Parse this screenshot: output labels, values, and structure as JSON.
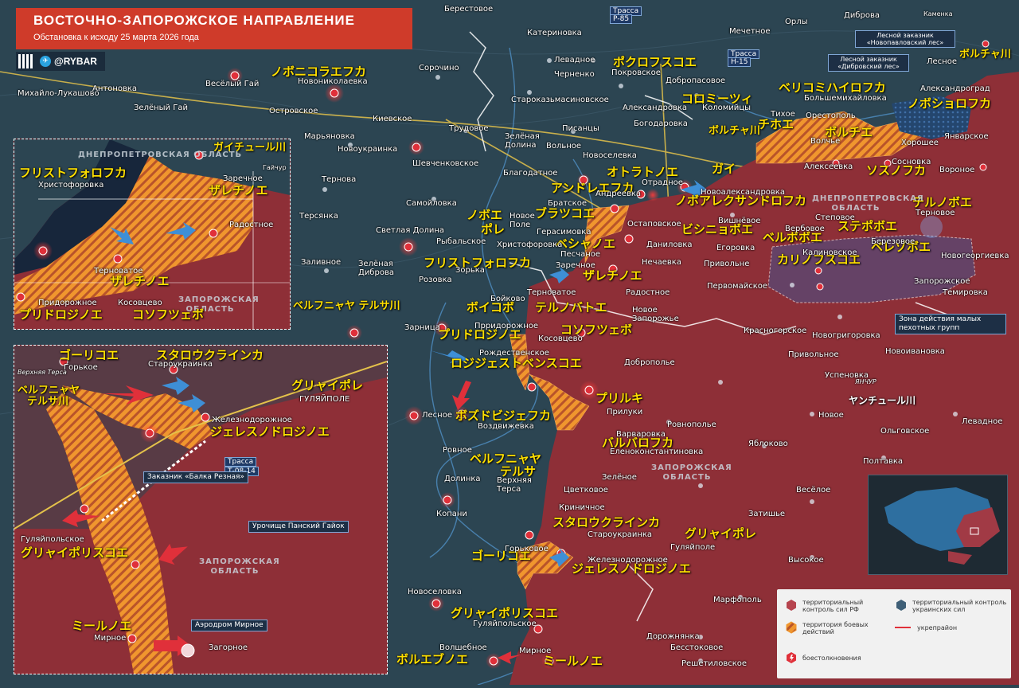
{
  "header": {
    "title": "ВОСТОЧНО-ЗАПОРОЖСКОЕ НАПРАВЛЕНИЕ",
    "subtitle": "Обстановка к исходу 25 марта 2026 года",
    "brand": "@RYBAR"
  },
  "colors": {
    "ru_control": "#8e2f37",
    "ua_control": "#2c4552",
    "contested": "#f0962e",
    "clash": "#e0303a",
    "jp_label": "#ffe000",
    "header_red": "#cf3b2a"
  },
  "jp_labels": [
    "ノボニコラエフカ",
    "ポクロフスコエ",
    "ボルチャ川",
    "ベリコミハイロフカ",
    "ノボショロフカ",
    "コロミーツィ",
    "ボルチャ川",
    "チホエ",
    "ボルチエ",
    "ソスノフカ",
    "オトラトノエ",
    "ガイ",
    "アンドレエフカ",
    "ノボアレクサンドロフカ",
    "テルノボエ",
    "ノボエ",
    "ブラツコエ",
    "ポレ",
    "ベシャノエ",
    "ビシニョボエ",
    "ステポボエ",
    "ベルボボエ",
    "ベレゾボエ",
    "カリノフスコエ",
    "フリストフォロフカ",
    "ザレチノエ",
    "ボイコボ",
    "テルノバトエ",
    "コソフツェボ",
    "プリドロジノエ",
    "ロジジェストベンスコエ",
    "プリルキ",
    "ボズドビジェフカ",
    "バルバロフカ",
    "ベルフニャヤ",
    "テルサ",
    "スタロウクラインカ",
    "グリャイポレ",
    "ゴーリコエ",
    "ジェレスノドロジノエ",
    "グリャイポリスコエ",
    "ボルエブノエ",
    "ミールノエ",
    "ベルフニャヤ テルサ川"
  ],
  "places": [
    "Берестовое",
    "Трасса",
    "Р-85",
    "Каменка",
    "Дибровa",
    "Орлы",
    "Мечетное",
    "Дибровa",
    "Катериновка",
    "Весёлый Гай",
    "Михайло-Лукашово",
    "Антоновка",
    "Зелёный Гай",
    "Новониколаевка",
    "Островское",
    "Сорочино",
    "Левадное",
    "Черненко",
    "Покровское",
    "Добропасовое",
    "Трасса",
    "Н-15",
    "Лесной заказник «Новопавловский лес»",
    "Лесной заказник «Дибровский лес»",
    "Лесное",
    "Александроград",
    "Большемихайловка",
    "Коломийцы",
    "Киевское",
    "Трудовое",
    "Писанцы",
    "Богодаровка",
    "Александровка",
    "Староказьмасиновское",
    "Вольное",
    "Новоселевка",
    "Зелёная Долина",
    "Благодатное",
    "Марьяновка",
    "Новоукраинка",
    "Шевченковское",
    "Тернова",
    "Самойловка",
    "Терсянка",
    "Светлая Долина",
    "Зелёная Диброва",
    "Заливное",
    "Розовка",
    "Рыбальское",
    "Зорька",
    "Андреевка",
    "Братское",
    "Отрадное",
    "Новоалександровка",
    "Хорошее",
    "Сосновка",
    "Вороное",
    "Алексеевка",
    "Тихое",
    "Орестополь",
    "Волчье",
    "Январское",
    "Терновое",
    "Новогеоргиевка",
    "Запорожское",
    "Темировка",
    "Степовое",
    "Березовое",
    "Вербовое",
    "Калиновское",
    "Егоровка",
    "Вишнёвое",
    "Привольне",
    "Первомайское",
    "Нечаевка",
    "Даниловка",
    "Остаповское",
    "Герасимовка",
    "Новое Поле",
    "Христофоровка",
    "Песчаное",
    "Заречное",
    "Терноватое",
    "Бойково",
    "Радостное",
    "Новое Запорожье",
    "Красногорское",
    "Новогригоровка",
    "Новоивановка",
    "Прридорожное",
    "Косовцево",
    "Зарница",
    "Рождественское",
    "Добропольe",
    "Привольное",
    "Успеновка",
    "Лесное",
    "Прилуки",
    "Воздвижевка",
    "Ровнополье",
    "Варваровка",
    "Еленоконстантиновка",
    "Яблоково",
    "Новое",
    "Ольговское",
    "Левадное",
    "Полтавка",
    "Ровное",
    "Долинка",
    "Верхняя Терса",
    "Цветковое",
    "Зелёное",
    "Копани",
    "Криничное",
    "Затишье",
    "Весёлое",
    "Староукраинка",
    "Горьковое",
    "Железнодорожное",
    "Гуляйполе",
    "Новоселовка",
    "Гуляйпольское",
    "Марфополь",
    "Высокое",
    "Волшебное",
    "Мирное",
    "Бесстоковое",
    "Дорожнянка",
    "Решетиловское",
    "Зона действия малых пехотных групп"
  ],
  "inset_top": {
    "labels": [
      "ガイチュール川",
      "フリストフォロフカ",
      "ザレチノエ",
      "テルノバトエ",
      "プリドロジノエ",
      "コソフツェボ"
    ],
    "places": [
      "ДНЕПРОПЕТРОВСКАЯ ОБЛАСТЬ",
      "Христофоровка",
      "Заречное",
      "Гайчур",
      "Радостное",
      "Терноватое",
      "Придорожное",
      "Косовцево",
      "ЗАПОРОЖСКАЯ ОБЛАСТЬ"
    ]
  },
  "inset_bottom": {
    "labels": [
      "ゴーリコエ",
      "スタロウクラインカ",
      "グリャイポレ",
      "ベルフニャヤ",
      "テルサ川",
      "ジェレスノドロジノエ",
      "グリャイポリスコエ",
      "ミールノエ"
    ],
    "places": [
      "Верхняя Терса",
      "Горькое",
      "Староукраинка",
      "ГУЛЯЙПОЛЕ",
      "Железнодорожное",
      "Трасса",
      "Т-08-14",
      "Заказник «Балка Резная»",
      "Урочище Панский Гайок",
      "Гуляйпольское",
      "ЗАПОРОЖСКАЯ ОБЛАСТЬ",
      "Аэродром Мирное",
      "Мирное",
      "Загорное"
    ]
  },
  "regions": {
    "dnipro": "ДНЕПРОПЕТРОВСКАЯ ОБЛАСТЬ",
    "zaporozhye": "ЗАПОРОЖСКАЯ ОБЛАСТЬ",
    "yanchur": "ЯНЧУР",
    "yanchur_jp": "ヤンチュール川"
  },
  "legend": {
    "ru": "территориальный контроль сил РФ",
    "contested": "территория боевых действий",
    "clash": "боестолкновения",
    "ua": "территориальный контроль украинских сил",
    "fort": "укрепрайон"
  }
}
